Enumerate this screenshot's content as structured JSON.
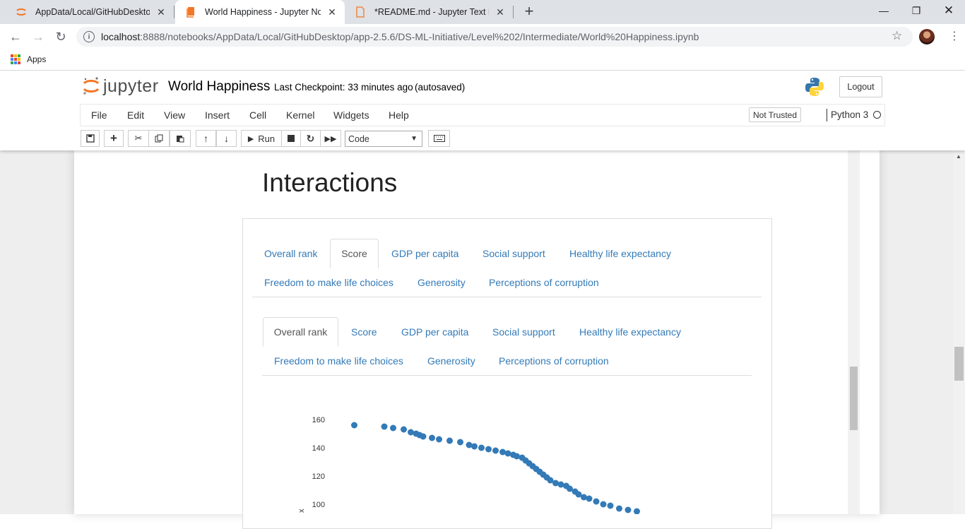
{
  "browser": {
    "tabs": [
      {
        "title": "AppData/Local/GitHubDesktop/a",
        "active": false
      },
      {
        "title": "World Happiness - Jupyter Noteb",
        "active": true
      },
      {
        "title": "*README.md - Jupyter Text Edito",
        "active": false
      }
    ],
    "url_host": "localhost",
    "url_rest": ":8888/notebooks/AppData/Local/GitHubDesktop/app-2.5.6/DS-ML-Initiative/Level%202/Intermediate/World%20Happiness.ipynb",
    "bookmarks_apps": "Apps"
  },
  "jupyter": {
    "logo_text": "jupyter",
    "notebook_name": "World Happiness",
    "checkpoint": "Last Checkpoint: 33 minutes ago",
    "autosaved": "(autosaved)",
    "logout": "Logout",
    "menu": [
      "File",
      "Edit",
      "View",
      "Insert",
      "Cell",
      "Kernel",
      "Widgets",
      "Help"
    ],
    "trust": "Not Trusted",
    "kernel": "Python 3",
    "run_label": "Run",
    "cell_type": "Code"
  },
  "notebook": {
    "heading": "Interactions",
    "outer_tabs": {
      "row1": [
        "Overall rank",
        "Score",
        "GDP per capita",
        "Social support",
        "Healthy life expectancy"
      ],
      "row2": [
        "Freedom to make life choices",
        "Generosity",
        "Perceptions of corruption"
      ],
      "active": "Score"
    },
    "inner_tabs": {
      "row1": [
        "Overall rank",
        "Score",
        "GDP per capita",
        "Social support",
        "Healthy life expectancy"
      ],
      "row2": [
        "Freedom to make life choices",
        "Generosity",
        "Perceptions of corruption"
      ],
      "active": "Overall rank"
    }
  },
  "chart_data": {
    "type": "scatter",
    "ylabel": "x",
    "y_ticks": [
      100,
      120,
      140,
      160
    ],
    "color": "#337ab7",
    "points": [
      [
        7.77,
        156
      ],
      [
        7.6,
        155
      ],
      [
        7.55,
        154
      ],
      [
        7.49,
        153
      ],
      [
        7.45,
        151
      ],
      [
        7.42,
        150
      ],
      [
        7.4,
        149
      ],
      [
        7.38,
        148
      ],
      [
        7.33,
        147
      ],
      [
        7.29,
        146
      ],
      [
        7.23,
        145
      ],
      [
        7.17,
        144
      ],
      [
        7.12,
        142
      ],
      [
        7.09,
        141
      ],
      [
        7.05,
        140
      ],
      [
        7.01,
        139
      ],
      [
        6.97,
        138
      ],
      [
        6.93,
        137
      ],
      [
        6.9,
        136
      ],
      [
        6.87,
        135
      ],
      [
        6.85,
        134
      ],
      [
        6.82,
        133
      ],
      [
        6.8,
        131
      ],
      [
        6.78,
        129
      ],
      [
        6.76,
        127
      ],
      [
        6.74,
        125
      ],
      [
        6.72,
        123
      ],
      [
        6.7,
        121
      ],
      [
        6.68,
        119
      ],
      [
        6.66,
        117
      ],
      [
        6.63,
        115
      ],
      [
        6.6,
        114
      ],
      [
        6.57,
        113
      ],
      [
        6.55,
        111
      ],
      [
        6.52,
        109
      ],
      [
        6.5,
        107
      ],
      [
        6.47,
        105
      ],
      [
        6.44,
        104
      ],
      [
        6.4,
        102
      ],
      [
        6.36,
        100
      ],
      [
        6.32,
        99
      ],
      [
        6.27,
        97
      ],
      [
        6.22,
        96
      ],
      [
        6.17,
        95
      ]
    ],
    "x_range": [
      7.8,
      2.8
    ],
    "y_range": [
      90,
      162
    ]
  }
}
